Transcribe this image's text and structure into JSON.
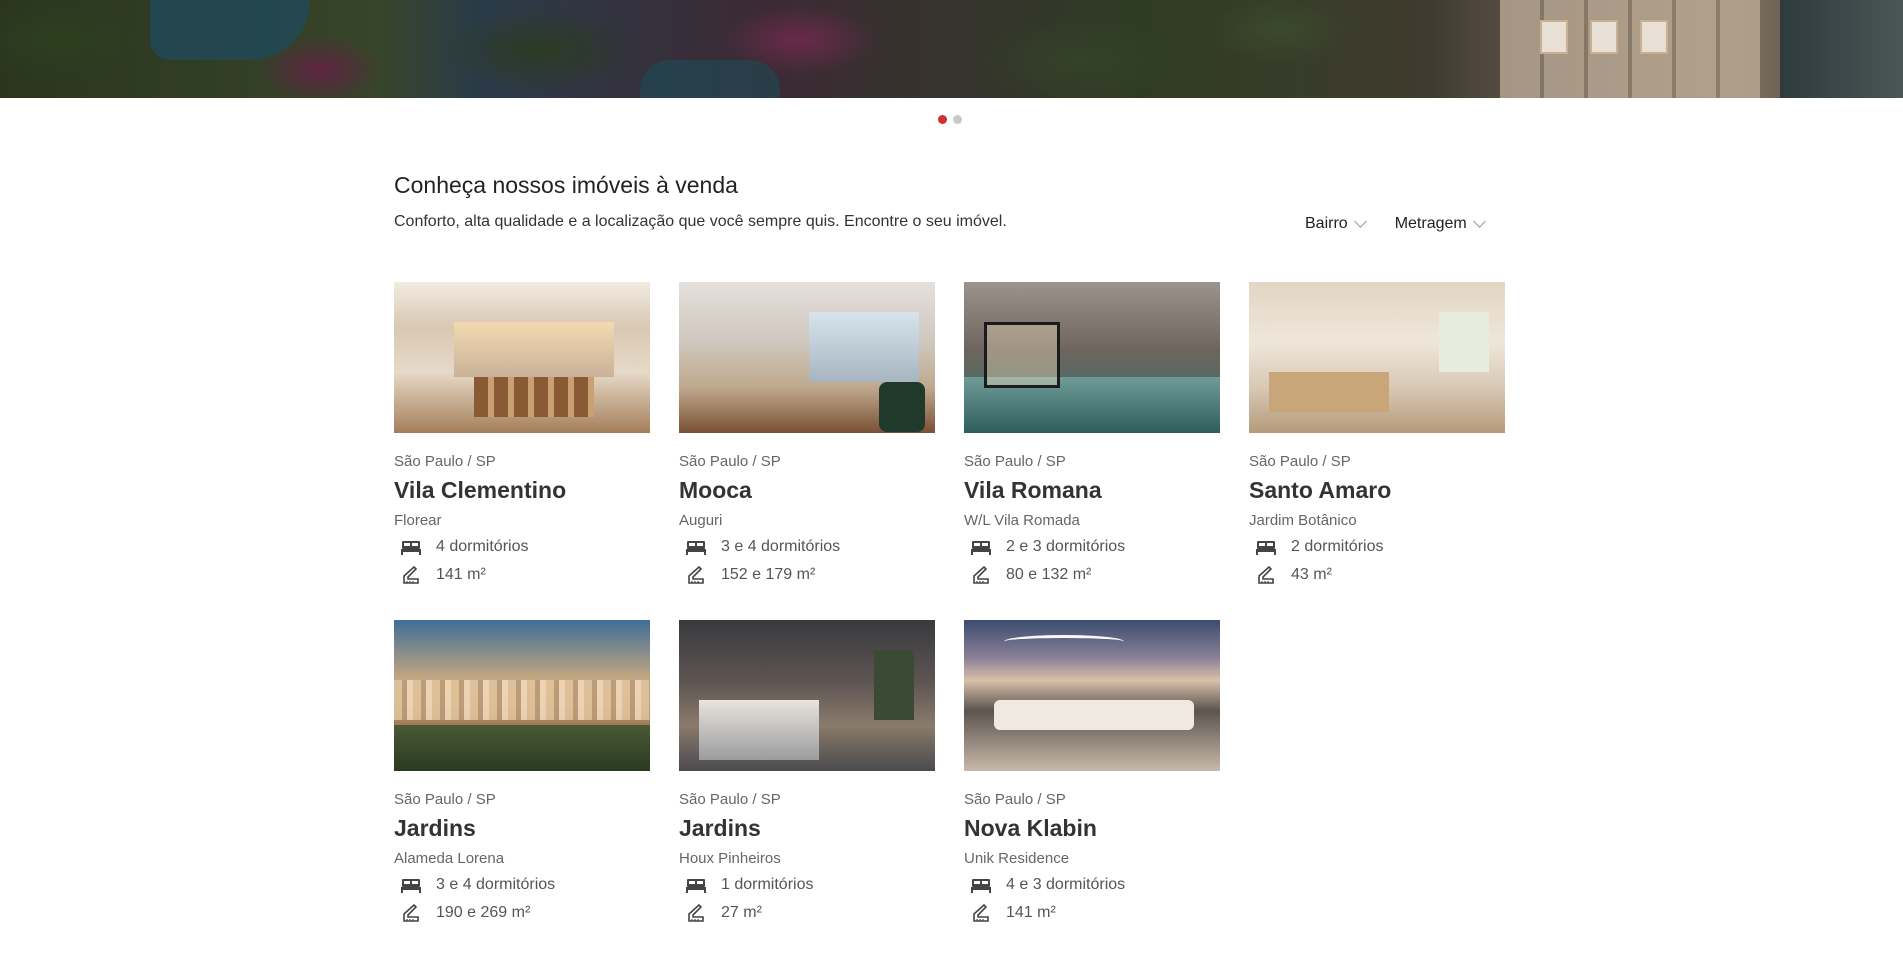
{
  "carousel": {
    "slides": 2,
    "active_index": 0
  },
  "section": {
    "title": "Conheça nossos imóveis à venda",
    "subtitle": "Conforto, alta qualidade e a localização que você sempre quis. Encontre o seu imóvel."
  },
  "filters": [
    {
      "label": "Bairro"
    },
    {
      "label": "Metragem"
    }
  ],
  "icons": {
    "bed": "bed-icon",
    "area": "ruler-icon",
    "chevron": "chevron-down-icon"
  },
  "colors": {
    "accent": "#d32f2f",
    "dot_inactive": "#c9c9c9"
  },
  "properties": [
    {
      "location": "São Paulo / SP",
      "neighborhood": "Vila Clementino",
      "development": "Florear",
      "bedrooms": "4 dormitórios",
      "area": "141 m²"
    },
    {
      "location": "São Paulo / SP",
      "neighborhood": "Mooca",
      "development": "Auguri",
      "bedrooms": "3 e 4 dormitórios",
      "area": "152 e 179 m²"
    },
    {
      "location": "São Paulo / SP",
      "neighborhood": "Vila Romana",
      "development": "W/L Vila Romada",
      "bedrooms": "2 e 3 dormitórios",
      "area": "80 e 132 m²"
    },
    {
      "location": "São Paulo / SP",
      "neighborhood": "Santo Amaro",
      "development": "Jardim Botânico",
      "bedrooms": "2 dormitórios",
      "area": "43 m²"
    },
    {
      "location": "São Paulo / SP",
      "neighborhood": "Jardins",
      "development": "Alameda Lorena",
      "bedrooms": "3 e 4 dormitórios",
      "area": "190 e 269 m²"
    },
    {
      "location": "São Paulo / SP",
      "neighborhood": "Jardins",
      "development": "Houx Pinheiros",
      "bedrooms": "1 dormitórios",
      "area": "27 m²"
    },
    {
      "location": "São Paulo / SP",
      "neighborhood": "Nova Klabin",
      "development": "Unik Residence",
      "bedrooms": "4 e 3 dormitórios",
      "area": "141 m²"
    }
  ]
}
